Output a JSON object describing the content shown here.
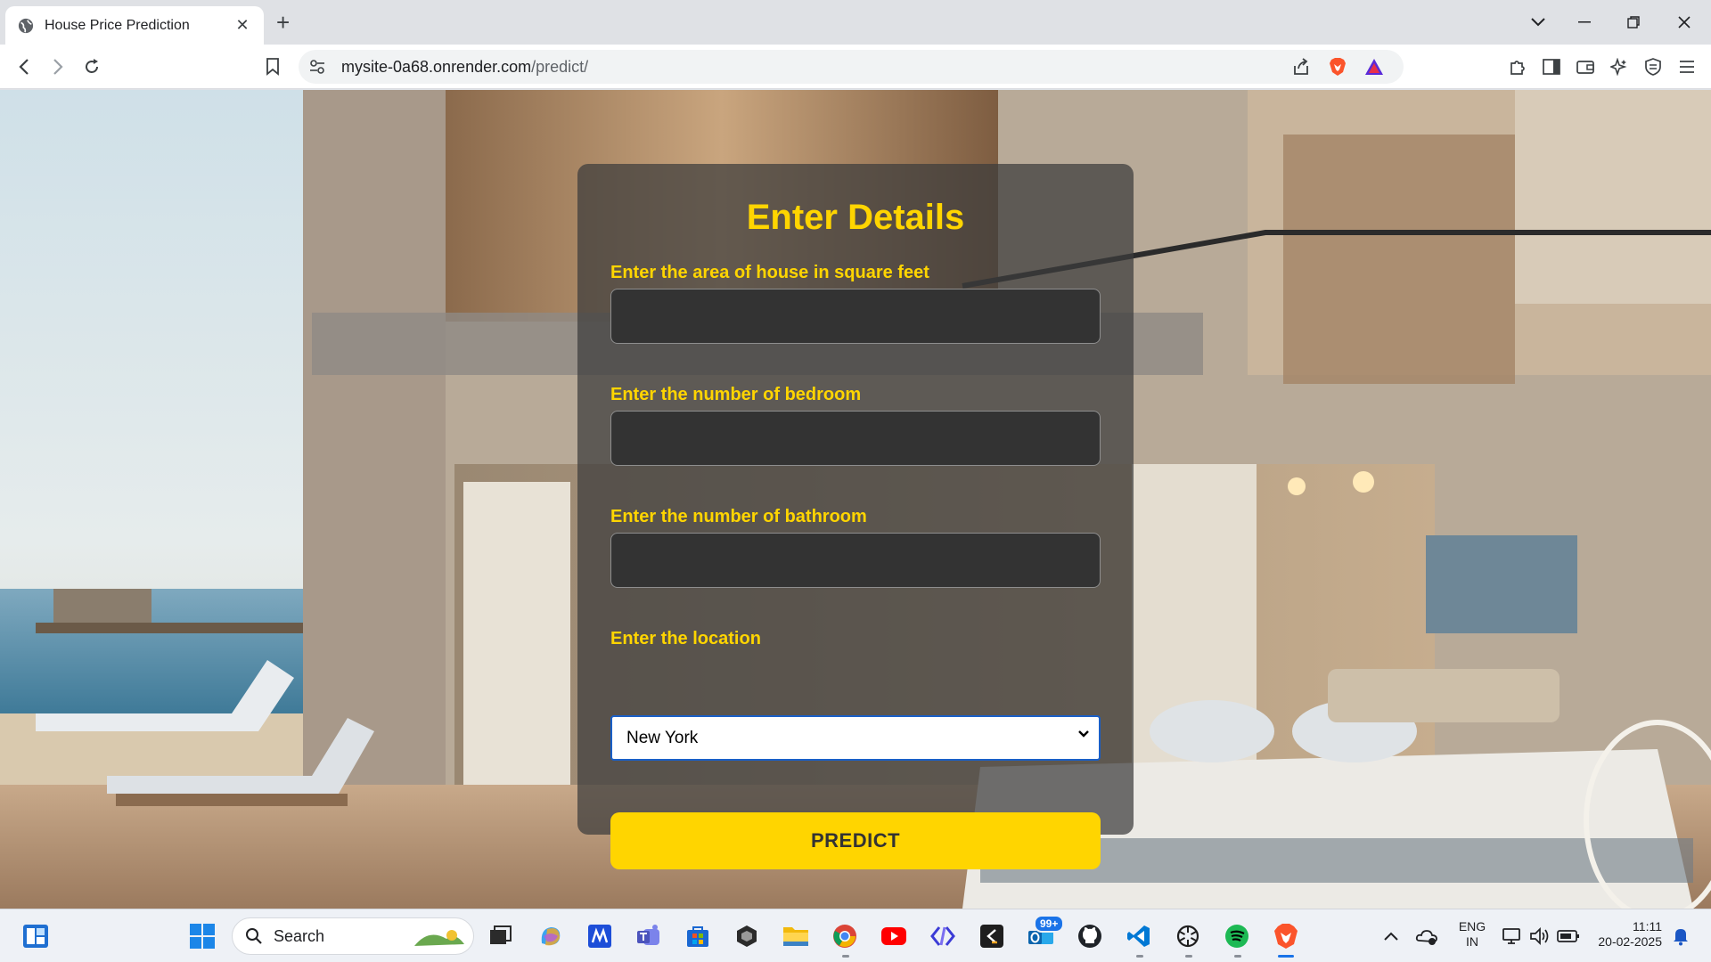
{
  "browser": {
    "tab_title": "House Price Prediction",
    "tab_close": "✕",
    "new_tab": "+",
    "url_host": "mysite-0a68.onrender.com",
    "url_path": "/predict/"
  },
  "form": {
    "title": "Enter Details",
    "area_label": "Enter the area of house in square feet",
    "bedroom_label": "Enter the number of bedroom",
    "bathroom_label": "Enter the number of bathroom",
    "location_label": "Enter the location",
    "area_value": "",
    "bedroom_value": "",
    "bathroom_value": "",
    "location_value": "New York",
    "predict_label": "PREDICT"
  },
  "taskbar": {
    "search_label": "Search",
    "mail_badge": "99+",
    "lang_line1": "ENG",
    "lang_line2": "IN",
    "time": "11:11",
    "date": "20-02-2025"
  },
  "colors": {
    "accent_yellow": "#ffd500",
    "panel_bg": "#3c3c3c",
    "field_bg": "#333333",
    "select_border": "#1a5fc7"
  }
}
